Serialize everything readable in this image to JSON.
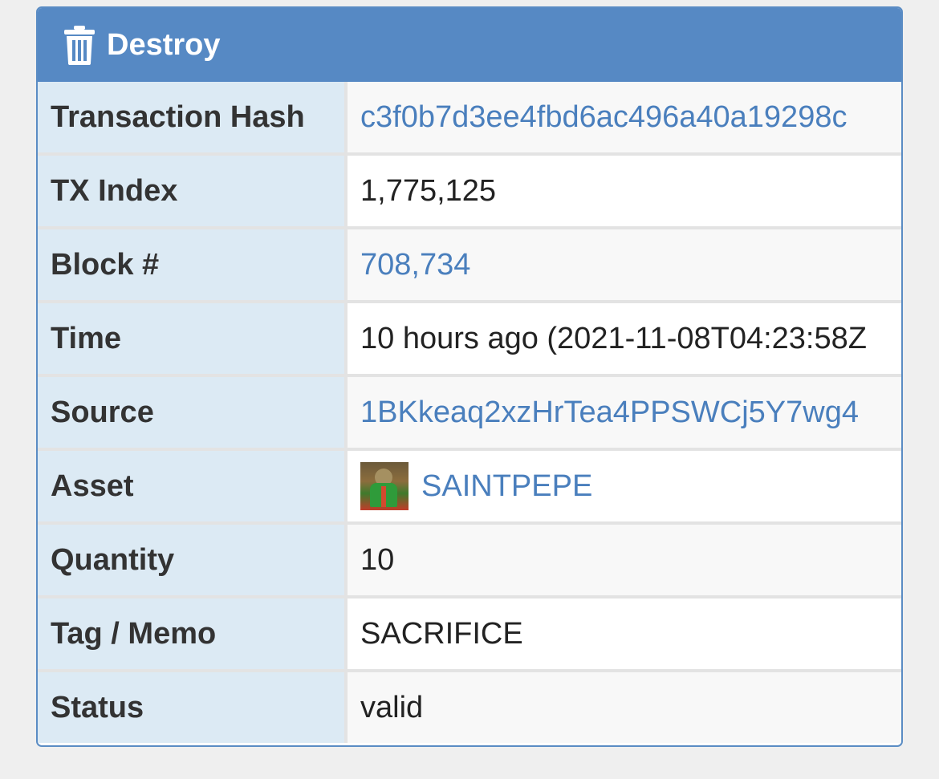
{
  "panel": {
    "title": "Destroy",
    "icon": "trash-icon"
  },
  "rows": [
    {
      "label": "Transaction Hash",
      "value": "c3f0b7d3ee4fbd6ac496a40a19298c",
      "link": true
    },
    {
      "label": "TX Index",
      "value": "1,775,125",
      "link": false
    },
    {
      "label": "Block #",
      "value": "708,734",
      "link": true
    },
    {
      "label": "Time",
      "value": "10 hours ago (2021-11-08T04:23:58Z",
      "link": false
    },
    {
      "label": "Source",
      "value": "1BKkeaq2xzHrTea4PPSWCj5Y7wg4",
      "link": true
    },
    {
      "label": "Asset",
      "value": "SAINTPEPE",
      "link": true
    },
    {
      "label": "Quantity",
      "value": "10",
      "link": false
    },
    {
      "label": "Tag / Memo",
      "value": "SACRIFICE",
      "link": false
    },
    {
      "label": "Status",
      "value": "valid",
      "link": false
    }
  ],
  "colors": {
    "header": "#5689c4",
    "label_bg": "#dceaf4",
    "link": "#4a7fbd"
  }
}
